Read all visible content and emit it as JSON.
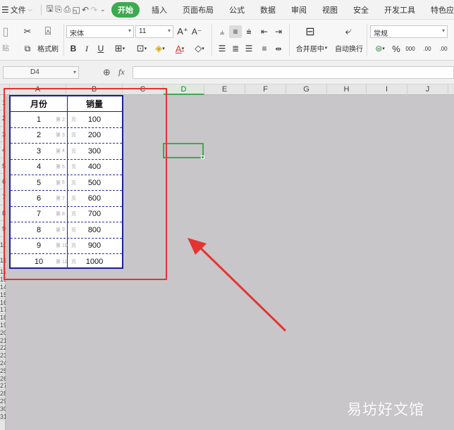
{
  "menubar": {
    "file_label": "文件",
    "tabs": [
      "开始",
      "插入",
      "页面布局",
      "公式",
      "数据",
      "审阅",
      "视图",
      "安全",
      "开发工具",
      "特色应"
    ],
    "active_tab": "开始"
  },
  "ribbon": {
    "paste_label": "贴",
    "format_painter_label": "格式刷",
    "font_name": "宋体",
    "font_size": "11",
    "merge_label": "合并居中",
    "wrap_label": "自动换行",
    "number_format": "常规",
    "percent_symbol": "%",
    "thousands_symbol": "000",
    "inc_decimal": ".00",
    "dec_decimal": ".00"
  },
  "formula": {
    "cell_ref": "D4",
    "fx_label": "fx"
  },
  "columns": [
    "A",
    "B",
    "C",
    "D",
    "E",
    "F",
    "G",
    "H",
    "I",
    "J"
  ],
  "active_column": "D",
  "rows": [
    "1",
    "2",
    "3",
    "4",
    "5",
    "6",
    "7",
    "8",
    "9",
    "10",
    "11",
    "12",
    "13",
    "14",
    "15",
    "16",
    "17",
    "18",
    "19",
    "20",
    "21",
    "22",
    "23",
    "24",
    "25",
    "26",
    "27",
    "28",
    "29",
    "30",
    "31"
  ],
  "table": {
    "headers": [
      "月份",
      "销量"
    ],
    "rows": [
      {
        "month": "1",
        "sales": "100",
        "page": "2"
      },
      {
        "month": "2",
        "sales": "200",
        "page": "3"
      },
      {
        "month": "3",
        "sales": "300",
        "page": "4"
      },
      {
        "month": "4",
        "sales": "400",
        "page": "5"
      },
      {
        "month": "5",
        "sales": "500",
        "page": "6"
      },
      {
        "month": "6",
        "sales": "600",
        "page": "7"
      },
      {
        "month": "7",
        "sales": "700",
        "page": "8"
      },
      {
        "month": "8",
        "sales": "800",
        "page": "9"
      },
      {
        "month": "9",
        "sales": "900",
        "page": "10"
      },
      {
        "month": "10",
        "sales": "1000",
        "page": "11"
      }
    ],
    "page_prefix": "第",
    "page_suffix": "页"
  },
  "watermark": "易坊好文馆",
  "colors": {
    "accent_green": "#3daa4f",
    "highlight_red": "#e53333",
    "table_border": "#1d1d9c",
    "sheet_bg": "#c8c6c8"
  }
}
